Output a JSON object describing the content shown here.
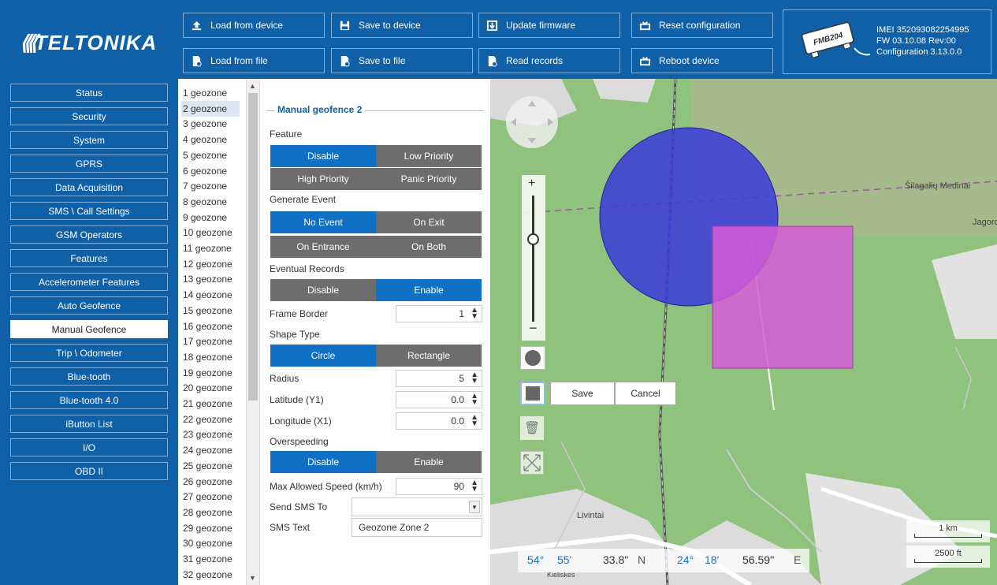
{
  "brand": {
    "logo_text": "TELTONIKA",
    "primary_color": "#1060a8"
  },
  "toolbar": {
    "load_device": "Load from device",
    "save_device": "Save to device",
    "update_firmware": "Update firmware",
    "reset_config": "Reset configuration",
    "load_file": "Load from file",
    "save_file": "Save to file",
    "read_records": "Read records",
    "reboot": "Reboot device"
  },
  "device": {
    "model": "FMB204",
    "imei": "IMEI 352093082254995",
    "fw": "FW 03.10.08 Rev:00",
    "config": "Configuration 3.13.0.0"
  },
  "nav": {
    "items": [
      "Status",
      "Security",
      "System",
      "GPRS",
      "Data Acquisition",
      "SMS \\ Call Settings",
      "GSM Operators",
      "Features",
      "Accelerometer Features",
      "Auto Geofence",
      "Manual Geofence",
      "Trip \\ Odometer",
      "Blue-tooth",
      "Blue-tooth 4.0",
      "iButton List",
      "I/O",
      "OBD II"
    ],
    "active": "Manual Geofence"
  },
  "geozones": {
    "items": [
      "1 geozone",
      "2 geozone",
      "3 geozone",
      "4 geozone",
      "5 geozone",
      "6 geozone",
      "7 geozone",
      "8 geozone",
      "9 geozone",
      "10 geozone",
      "11 geozone",
      "12 geozone",
      "13 geozone",
      "14 geozone",
      "15 geozone",
      "16 geozone",
      "17 geozone",
      "18 geozone",
      "19 geozone",
      "20 geozone",
      "21 geozone",
      "22 geozone",
      "23 geozone",
      "24 geozone",
      "25 geozone",
      "26 geozone",
      "27 geozone",
      "28 geozone",
      "29 geozone",
      "30 geozone",
      "31 geozone",
      "32 geozone"
    ],
    "selected": "2 geozone"
  },
  "panel": {
    "title": "Manual geofence 2",
    "feature": {
      "label": "Feature",
      "options": [
        "Disable",
        "Low Priority",
        "High Priority",
        "Panic Priority"
      ],
      "selected": "Disable"
    },
    "generate_event": {
      "label": "Generate Event",
      "options": [
        "No Event",
        "On Exit",
        "On Entrance",
        "On Both"
      ],
      "selected": "No Event"
    },
    "eventual_records": {
      "label": "Eventual Records",
      "options": [
        "Disable",
        "Enable"
      ],
      "selected": "Enable"
    },
    "frame_border": {
      "label": "Frame Border",
      "value": "1"
    },
    "shape_type": {
      "label": "Shape Type",
      "options": [
        "Circle",
        "Rectangle"
      ],
      "selected": "Circle"
    },
    "radius": {
      "label": "Radius",
      "value": "5"
    },
    "latitude": {
      "label": "Latitude (Y1)",
      "value": "0.0"
    },
    "longitude": {
      "label": "Longitude (X1)",
      "value": "0.0"
    },
    "overspeeding": {
      "label": "Overspeeding",
      "options": [
        "Disable",
        "Enable"
      ],
      "selected": "Disable"
    },
    "max_speed": {
      "label": "Max Allowed Speed (km/h)",
      "value": "90"
    },
    "send_sms": {
      "label": "Send SMS To",
      "value": ""
    },
    "sms_text": {
      "label": "SMS Text",
      "value": "Geozone Zone 2"
    }
  },
  "map": {
    "places": {
      "silagaliu": "Šilagalių Medinai",
      "jagoro": "Jagoro",
      "livintai": "Livintai",
      "kieliskes": "Kieliskes"
    },
    "save": "Save",
    "cancel": "Cancel",
    "coords": {
      "lat_deg": "54°",
      "lat_min": "55'",
      "lat_sec": "33.8''",
      "lat_hem": "N",
      "lon_deg": "24°",
      "lon_min": "18'",
      "lon_sec": "56.59''",
      "lon_hem": "E"
    },
    "scale_km": "1 km",
    "scale_ft": "2500 ft",
    "circle_color": "#3a3adb",
    "rect_color": "#d65ad6"
  }
}
